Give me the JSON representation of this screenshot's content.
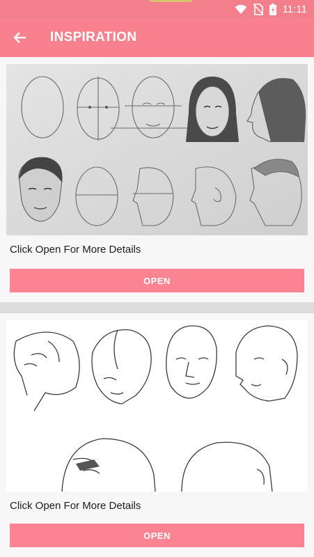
{
  "status_bar": {
    "time": "11:11",
    "icons": [
      "wifi-icon",
      "no-sim-icon",
      "battery-icon"
    ],
    "color": "#f47f8c"
  },
  "app_bar": {
    "title": "INSPIRATION",
    "back_icon": "arrow-left-icon",
    "color": "#f8818d"
  },
  "cards": [
    {
      "image_desc": "pencil sketches of face proportions",
      "caption": "Click Open For More Details",
      "button_label": "OPEN"
    },
    {
      "image_desc": "line drawings of heads at different angles",
      "caption": "Click Open For More Details",
      "button_label": "OPEN"
    }
  ],
  "accent": "#fb8492"
}
